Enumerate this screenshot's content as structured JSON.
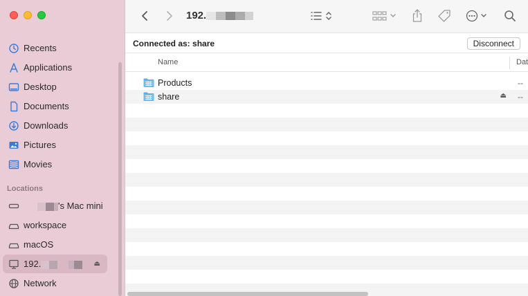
{
  "window": {
    "title_prefix": "192."
  },
  "sidebar": {
    "favorites": [
      {
        "label": "Recents",
        "icon": "clock-icon"
      },
      {
        "label": "Applications",
        "icon": "applications-icon"
      },
      {
        "label": "Desktop",
        "icon": "desktop-icon"
      },
      {
        "label": "Documents",
        "icon": "document-icon"
      },
      {
        "label": "Downloads",
        "icon": "download-icon"
      },
      {
        "label": "Pictures",
        "icon": "pictures-icon"
      },
      {
        "label": "Movies",
        "icon": "movies-icon"
      }
    ],
    "locations_heading": "Locations",
    "locations": [
      {
        "label": "'s Mac mini",
        "icon": "drive-icon"
      },
      {
        "label": "workspace",
        "icon": "drive-icon"
      },
      {
        "label": "macOS",
        "icon": "drive-icon"
      },
      {
        "label": "192.",
        "icon": "server-icon",
        "selected": true
      },
      {
        "label": "Network",
        "icon": "network-icon"
      }
    ],
    "eject_glyph": "⏏"
  },
  "connection": {
    "text": "Connected as: share",
    "disconnect_label": "Disconnect"
  },
  "list": {
    "columns": {
      "name": "Name",
      "date": "Dat"
    },
    "items": [
      {
        "name": "Products",
        "date": "--",
        "icon": "folder-icon"
      },
      {
        "name": "share",
        "date": "--",
        "icon": "folder-icon",
        "eject": "⏏"
      }
    ]
  },
  "colors": {
    "sidebar_bg": "#e9ccd6",
    "folder_blue": "#5aaee8"
  }
}
